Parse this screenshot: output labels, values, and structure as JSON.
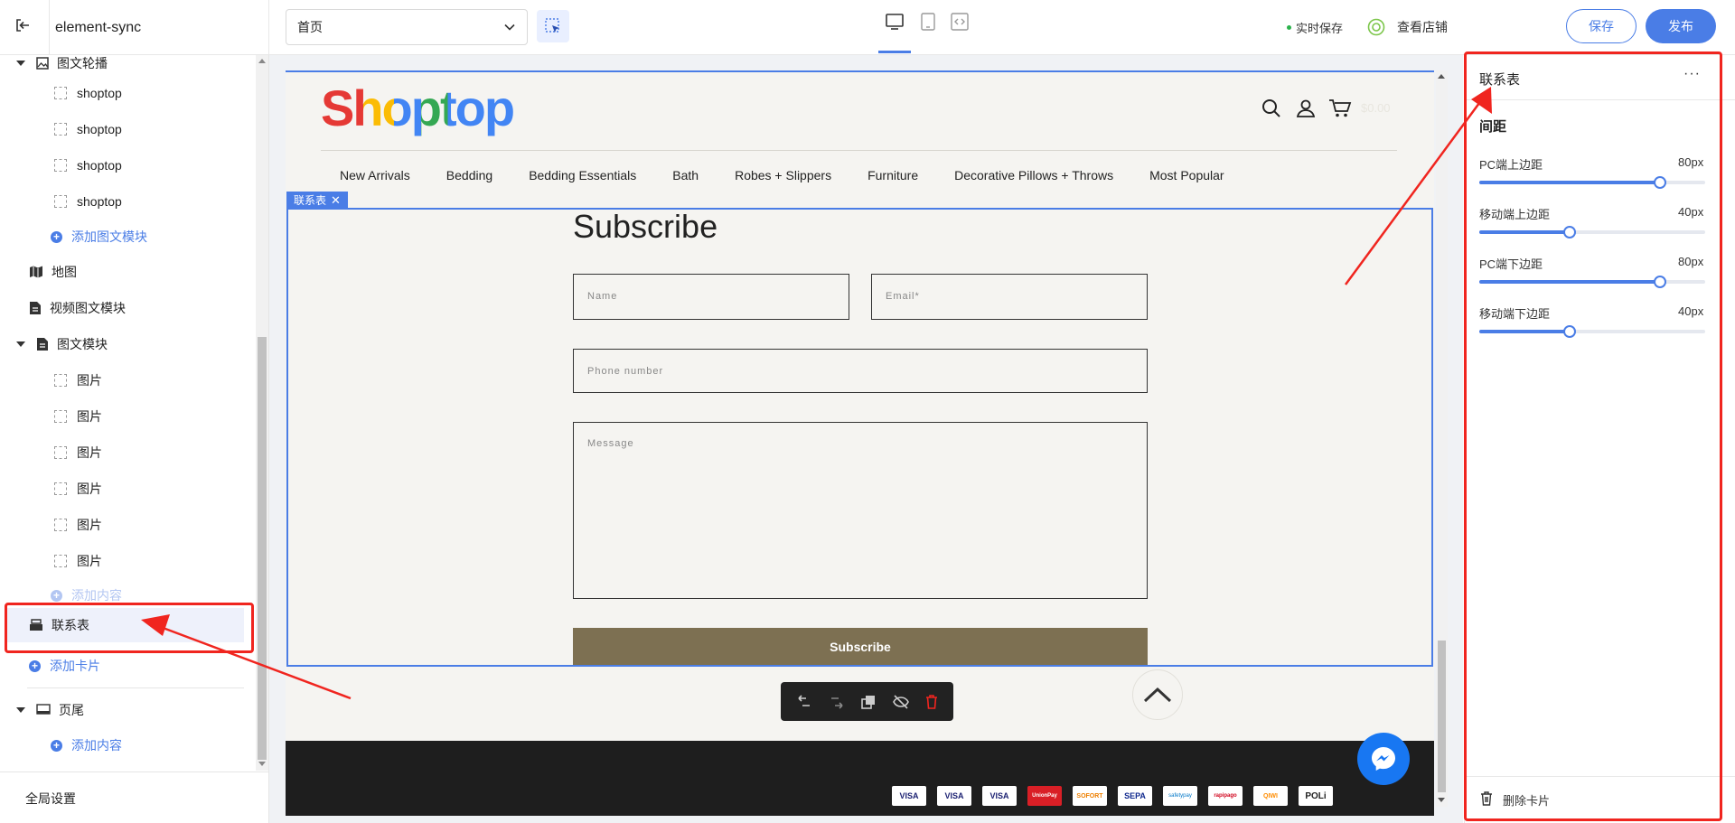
{
  "topbar": {
    "app_title": "element-sync",
    "page_select": "首页",
    "realtime_save": "实时保存",
    "view_store": "查看店铺",
    "save_label": "保存",
    "publish_label": "发布"
  },
  "sidebar": {
    "carousel_group": "图文轮播",
    "carousel_items": [
      "shoptop",
      "shoptop",
      "shoptop",
      "shoptop"
    ],
    "add_carousel": "添加图文模块",
    "map": "地图",
    "video": "视频图文模块",
    "image_text": "图文模块",
    "image_items": [
      "图片",
      "图片",
      "图片",
      "图片",
      "图片",
      "图片"
    ],
    "add_content": "添加内容",
    "contact_form": "联系表",
    "add_card": "添加卡片",
    "footer": "页尾",
    "add_footer_content": "添加内容",
    "global_settings": "全局设置"
  },
  "site": {
    "logo": "Shoptop",
    "cart_total": "$0.00",
    "nav": [
      "New Arrivals",
      "Bedding",
      "Bedding Essentials",
      "Bath",
      "Robes + Slippers",
      "Furniture",
      "Decorative Pillows + Throws",
      "Most Popular"
    ],
    "section_tag": "联系表",
    "subscribe_title": "Subscribe",
    "name_placeholder": "Name",
    "email_placeholder": "Email*",
    "phone_placeholder": "Phone number",
    "message_placeholder": "Message",
    "submit_label": "Subscribe",
    "payments": [
      "VISA",
      "VISA",
      "VISA",
      "UnionPay",
      "SOFORT",
      "SEPA",
      "safetypay",
      "rapipago",
      "QIWI",
      "POLi"
    ]
  },
  "rightpanel": {
    "title": "联系表",
    "section": "间距",
    "settings": [
      {
        "label": "PC端上边距",
        "value": "80px",
        "ratio": 0.8
      },
      {
        "label": "移动端上边距",
        "value": "40px",
        "ratio": 0.4
      },
      {
        "label": "PC端下边距",
        "value": "80px",
        "ratio": 0.8
      },
      {
        "label": "移动端下边距",
        "value": "40px",
        "ratio": 0.4
      }
    ],
    "delete_card": "删除卡片"
  },
  "colors": {
    "accent": "#4a7de6",
    "annotation": "#f0251f",
    "submit_bg": "#7d7052",
    "footer_bg": "#1e1e1e"
  }
}
